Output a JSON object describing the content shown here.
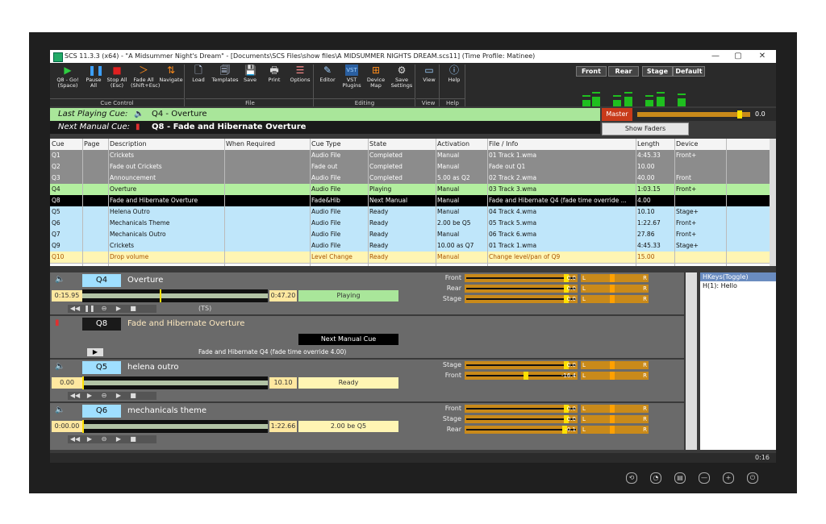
{
  "window": {
    "title": "SCS 11.3.3 (x64) - \"A Midsummer Night's Dream\" - [Documents\\SCS Files\\show files\\A MIDSUMMER NIGHTS DREAM.scs11] (Time Profile: Matinee)",
    "minimize": "—",
    "maximize": "▢",
    "close": "✕"
  },
  "toolbar": {
    "buttons": [
      {
        "label": "Q8 - Go!\n(Space)",
        "icon": "play-icon",
        "glyph": "▶",
        "color": "#2ecc40"
      },
      {
        "label": "Pause\nAll",
        "icon": "pause-icon",
        "glyph": "❚❚",
        "color": "#3ca0ff"
      },
      {
        "label": "Stop All\n(Esc)",
        "icon": "stop-icon",
        "glyph": "■",
        "color": "#e02020"
      },
      {
        "label": "Fade All\n(Shift+Esc)",
        "icon": "fade-icon",
        "glyph": "＞",
        "color": "#ff8c1a"
      },
      {
        "label": "Navigate",
        "icon": "navigate-icon",
        "glyph": "⇅",
        "color": "#ff8c1a"
      },
      {
        "label": "Load",
        "icon": "load-icon",
        "glyph": "🗋",
        "color": "#cfe0ff"
      },
      {
        "label": "Templates",
        "icon": "templates-icon",
        "glyph": "🗐",
        "color": "#cfe0ff"
      },
      {
        "label": "Save",
        "icon": "save-icon",
        "glyph": "💾",
        "color": "#8fb4ff"
      },
      {
        "label": "Print",
        "icon": "print-icon",
        "glyph": "🖶",
        "color": "#ddd"
      },
      {
        "label": "Options",
        "icon": "options-icon",
        "glyph": "☰",
        "color": "#ff8c8c"
      },
      {
        "label": "Editor",
        "icon": "editor-icon",
        "glyph": "✎",
        "color": "#9fd0ff"
      },
      {
        "label": "VST\nPlugins",
        "icon": "vst-icon",
        "glyph": "VST",
        "color": "#9fd0ff"
      },
      {
        "label": "Device\nMap",
        "icon": "device-map-icon",
        "glyph": "⊞",
        "color": "#ff8c1a"
      },
      {
        "label": "Save\nSettings",
        "icon": "save-settings-icon",
        "glyph": "⚙",
        "color": "#ddd"
      },
      {
        "label": "View",
        "icon": "view-icon",
        "glyph": "▭",
        "color": "#9fd0ff"
      },
      {
        "label": "Help",
        "icon": "help-icon",
        "glyph": "ⓘ",
        "color": "#9fd0ff"
      }
    ],
    "groups": [
      "Cue Control",
      "File",
      "Editing",
      "View",
      "Help"
    ]
  },
  "speakers": [
    "Front",
    "Rear",
    "Stage",
    "Default"
  ],
  "master": {
    "label": "Master",
    "value": "0.0"
  },
  "show_faders": "Show Faders",
  "last_cue": {
    "label": "Last Playing Cue:",
    "text": "Q4 - Overture"
  },
  "next_cue": {
    "label": "Next Manual Cue:",
    "text": "Q8 - Fade and Hibernate Overture"
  },
  "grid": {
    "columns": [
      "Cue",
      "Page",
      "Description",
      "When Required",
      "Cue Type",
      "State",
      "Activation",
      "File / Info",
      "Length",
      "Device"
    ],
    "rows": [
      {
        "cue": "Q1",
        "page": "",
        "desc": "Crickets",
        "when": "",
        "type": "Audio File",
        "state": "Completed",
        "act": "Manual",
        "file": "01 Track 1.wma",
        "len": "4:45.33",
        "dev": "Front+",
        "bg": "#8c8c8c",
        "fg": "#ffffff"
      },
      {
        "cue": "Q2",
        "page": "",
        "desc": "Fade out Crickets",
        "when": "",
        "type": "Fade out",
        "state": "Completed",
        "act": "Manual",
        "file": "Fade out Q1",
        "len": "10.00",
        "dev": "",
        "bg": "#8c8c8c",
        "fg": "#ffffff"
      },
      {
        "cue": "Q3",
        "page": "",
        "desc": "Announcement",
        "when": "",
        "type": "Audio File",
        "state": "Completed",
        "act": "5.00 as Q2",
        "file": "02 Track 2.wma",
        "len": "40.00",
        "dev": "Front",
        "bg": "#8c8c8c",
        "fg": "#ffffff"
      },
      {
        "cue": "Q4",
        "page": "",
        "desc": "Overture",
        "when": "",
        "type": "Audio File",
        "state": "Playing",
        "act": "Manual",
        "file": "03 Track 3.wma",
        "len": "1:03.15",
        "dev": "Front+",
        "bg": "#b3ef9f",
        "fg": "#111111"
      },
      {
        "cue": "Q8",
        "page": "",
        "desc": "Fade and Hibernate Overture",
        "when": "",
        "type": "Fade&Hib",
        "state": "Next Manual",
        "act": "Manual",
        "file": "Fade and Hibernate Q4  (fade time override ...",
        "len": "4.00",
        "dev": "",
        "bg": "#000000",
        "fg": "#ffffff"
      },
      {
        "cue": "Q5",
        "page": "",
        "desc": "Helena Outro",
        "when": "",
        "type": "Audio File",
        "state": "Ready",
        "act": "Manual",
        "file": "04 Track 4.wma",
        "len": "10.10",
        "dev": "Stage+",
        "bg": "#bfe6fa",
        "fg": "#111111"
      },
      {
        "cue": "Q6",
        "page": "",
        "desc": "Mechanicals Theme",
        "when": "",
        "type": "Audio File",
        "state": "Ready",
        "act": "2.00 be Q5",
        "file": "05 Track 5.wma",
        "len": "1:22.67",
        "dev": "Front+",
        "bg": "#bfe6fa",
        "fg": "#111111"
      },
      {
        "cue": "Q7",
        "page": "",
        "desc": "Mechanicals Outro",
        "when": "",
        "type": "Audio File",
        "state": "Ready",
        "act": "Manual",
        "file": "06 Track 6.wma",
        "len": "27.86",
        "dev": "Front+",
        "bg": "#bfe6fa",
        "fg": "#111111"
      },
      {
        "cue": "Q9",
        "page": "",
        "desc": "Crickets",
        "when": "",
        "type": "Audio File",
        "state": "Ready",
        "act": "10.00 as Q7",
        "file": "01 Track 1.wma",
        "len": "4:45.33",
        "dev": "Stage+",
        "bg": "#bfe6fa",
        "fg": "#111111"
      },
      {
        "cue": "Q10",
        "page": "",
        "desc": "Drop volume",
        "when": "",
        "type": "Level Change",
        "state": "Ready",
        "act": "Manual",
        "file": "Change level/pan of Q9",
        "len": "15.00",
        "dev": "",
        "bg": "#fff5b3",
        "fg": "#aa5500"
      }
    ]
  },
  "panels": [
    {
      "cue": "Q4",
      "desc": "Overture",
      "start": "0:15.95",
      "end": "0:47.20",
      "state": "Playing",
      "state_bg": "#a9e69a",
      "progress": 0.42,
      "transport": [
        "◀◀",
        "❚❚",
        "⊖",
        "▶",
        "■"
      ],
      "extra": "(TS)",
      "devices": [
        {
          "name": "Front",
          "db": "0.0",
          "level": 0.93,
          "pan": 0.5
        },
        {
          "name": "Rear",
          "db": "0.0",
          "level": 0.93,
          "pan": 0.5
        },
        {
          "name": "Stage",
          "db": "0.0",
          "level": 0.93,
          "pan": 0.5
        }
      ]
    },
    {
      "cue": "Q8",
      "desc": "Fade and Hibernate Overture",
      "state": "Next Manual Cue",
      "info": "Fade and Hibernate Q4  (fade time override 4.00)",
      "play": "▶"
    },
    {
      "cue": "Q5",
      "desc": "helena outro",
      "start": "0.00",
      "end": "10.10",
      "state": "Ready",
      "state_bg": "#fff5b3",
      "progress": 0.0,
      "transport": [
        "◀◀",
        "▶",
        "⊖",
        "▶",
        "■"
      ],
      "devices": [
        {
          "name": "Stage",
          "db": "0.0",
          "level": 0.93,
          "pan": 0.5
        },
        {
          "name": "Front",
          "db": "-16.4",
          "level": 0.55,
          "pan": 0.5
        }
      ]
    },
    {
      "cue": "Q6",
      "desc": "mechanicals theme",
      "start": "0:00.00",
      "end": "1:22.66",
      "state": "2.00 be Q5",
      "state_bg": "#fff5b3",
      "progress": 0.0,
      "transport": [
        "◀◀",
        "▶",
        "⊖",
        "▶",
        "■"
      ],
      "devices": [
        {
          "name": "Front",
          "db": "0.0",
          "level": 0.93,
          "pan": 0.5
        },
        {
          "name": "Stage",
          "db": "0.0",
          "level": 0.93,
          "pan": 0.5
        },
        {
          "name": "Rear",
          "db": "-0.1",
          "level": 0.92,
          "pan": 0.5
        }
      ]
    }
  ],
  "hkeys": {
    "title": "HKeys(Toggle)",
    "item": "H(1): Hello"
  },
  "status": {
    "time": "0:16"
  },
  "bezel_buttons": [
    "⟲",
    "◔",
    "▤",
    "—",
    "+",
    "⏻"
  ],
  "colors": {
    "accent_orange": "#ff8c1a",
    "playing_green": "#a9e69a",
    "ready_yellow": "#fff5b3",
    "cue_blue": "#9fdfff",
    "master_red": "#c83a1a"
  }
}
